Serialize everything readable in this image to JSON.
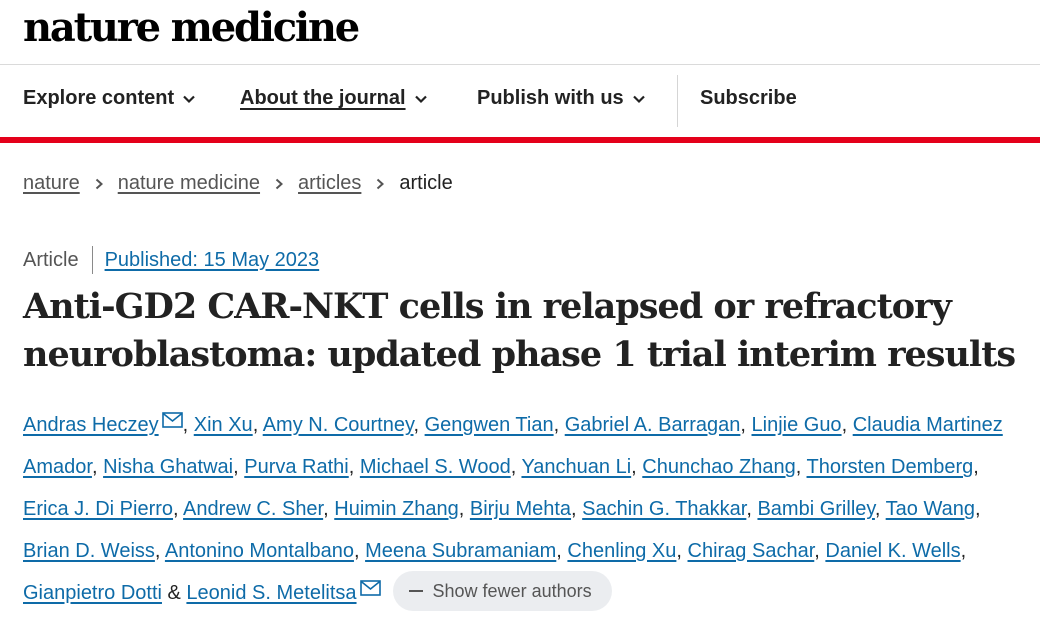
{
  "logo": "nature medicine",
  "nav": {
    "items": [
      {
        "label": "Explore content"
      },
      {
        "label": "About the journal"
      },
      {
        "label": "Publish with us"
      },
      {
        "label": "Subscribe"
      }
    ]
  },
  "breadcrumb": [
    "nature",
    "nature medicine",
    "articles",
    "article"
  ],
  "article": {
    "type": "Article",
    "published": "Published: 15 May 2023",
    "title": "Anti-GD2 CAR-NKT cells in relapsed or refractory neuroblastoma: updated phase 1 trial interim results"
  },
  "authors": {
    "list": [
      "Andras Heczey",
      "Xin Xu",
      "Amy N. Courtney",
      "Gengwen Tian",
      "Gabriel A. Barragan",
      "Linjie Guo",
      "Claudia Martinez Amador",
      "Nisha Ghatwai",
      "Purva Rathi",
      "Michael S. Wood",
      "Yanchuan Li",
      "Chunchao Zhang",
      "Thorsten Demberg",
      "Erica J. Di Pierro",
      "Andrew C. Sher",
      "Huimin Zhang",
      "Birju Mehta",
      "Sachin G. Thakkar",
      "Bambi Grilley",
      "Tao Wang",
      "Brian D. Weiss",
      "Antonino Montalbano",
      "Meena Subramaniam",
      "Chenling Xu",
      "Chirag Sachar",
      "Daniel K. Wells",
      "Gianpietro Dotti",
      "Leonid S. Metelitsa"
    ],
    "separator": ", ",
    "final_separator": " & ",
    "show_fewer_label": "Show fewer authors"
  },
  "icons": {
    "nav_chevron": "chevron-down-icon",
    "breadcrumb_separator": "chevron-right-icon",
    "corresponding": "mail-icon",
    "fewer": "minus-icon"
  },
  "colors": {
    "link": "#0e6ba8",
    "brand_bar": "#e4001a",
    "text": "#222222",
    "muted": "#555555",
    "pill_bg": "#ebedf0"
  }
}
